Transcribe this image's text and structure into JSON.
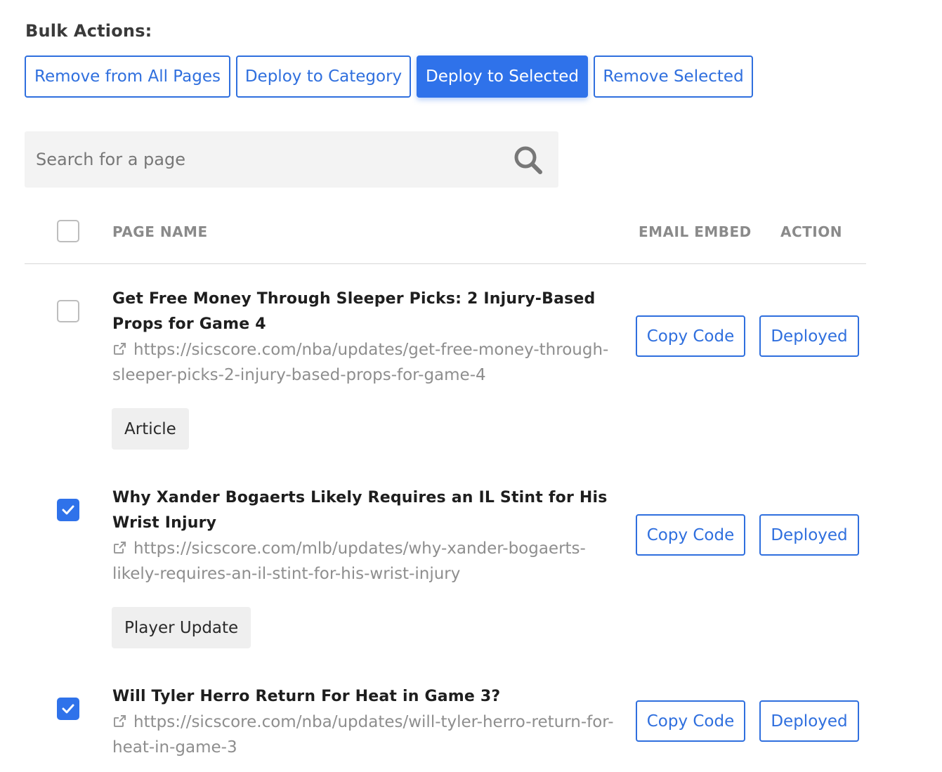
{
  "bulk_actions": {
    "title": "Bulk Actions:",
    "remove_all_label": "Remove from All Pages",
    "deploy_category_label": "Deploy to Category",
    "deploy_selected_label": "Deploy to Selected",
    "remove_selected_label": "Remove Selected"
  },
  "search": {
    "placeholder": "Search for a page"
  },
  "table": {
    "headers": {
      "page_name": "PAGE NAME",
      "email_embed": "EMAIL EMBED",
      "action": "ACTION"
    },
    "rows": [
      {
        "checked": false,
        "title": "Get Free Money Through Sleeper Picks: 2 Injury-Based Props for Game 4",
        "url": "https://sicscore.com/nba/updates/get-free-money-through-sleeper-picks-2-injury-based-props-for-game-4",
        "tag": "Article",
        "copy_label": "Copy Code",
        "status_label": "Deployed"
      },
      {
        "checked": true,
        "title": "Why Xander Bogaerts Likely Requires an IL Stint for His Wrist Injury",
        "url": "https://sicscore.com/mlb/updates/why-xander-bogaerts-likely-requires-an-il-stint-for-his-wrist-injury",
        "tag": "Player Update",
        "copy_label": "Copy Code",
        "status_label": "Deployed"
      },
      {
        "checked": true,
        "title": "Will Tyler Herro Return For Heat in Game 3?",
        "url": "https://sicscore.com/nba/updates/will-tyler-herro-return-for-heat-in-game-3",
        "copy_label": "Copy Code",
        "status_label": "Deployed"
      }
    ]
  },
  "colors": {
    "accent": "#2f72ea",
    "muted_text": "#8e8e8e",
    "tag_bg": "#efefef"
  },
  "icons": [
    "search-icon",
    "external-link-icon",
    "check-icon"
  ]
}
